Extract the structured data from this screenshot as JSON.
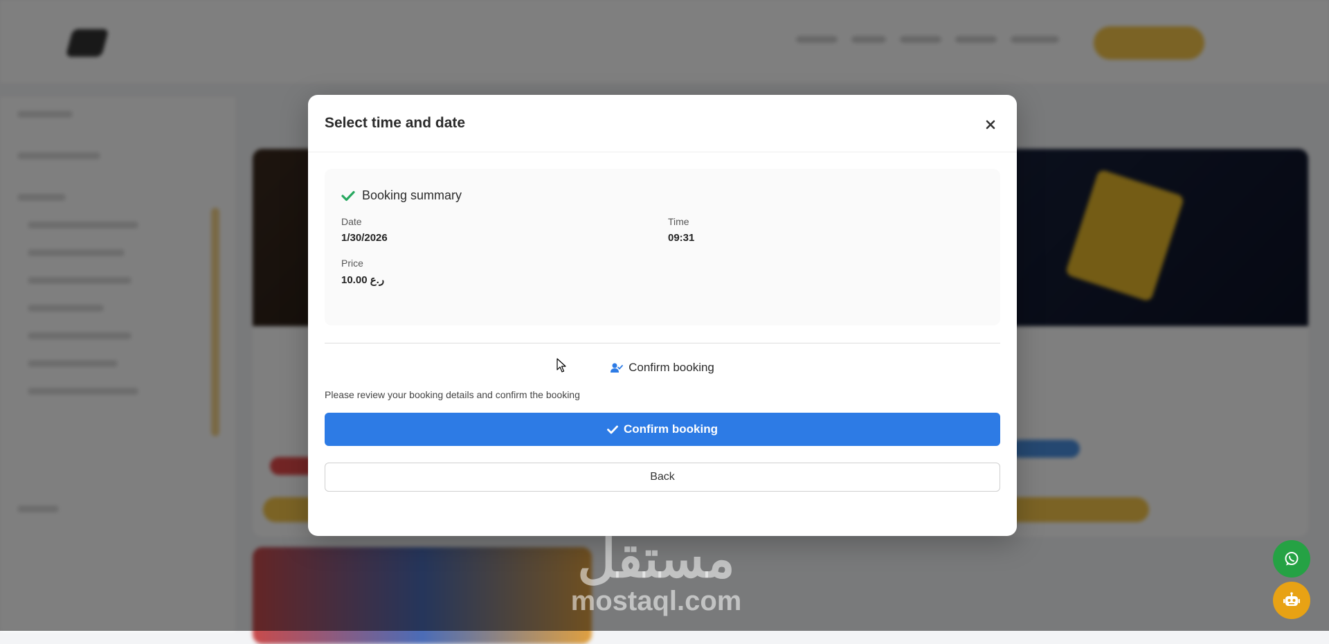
{
  "modal": {
    "title": "Select time and date",
    "close_icon": "close-icon",
    "summary": {
      "heading": "Booking summary",
      "date_label": "Date",
      "date_value": "1/30/2026",
      "time_label": "Time",
      "time_value": "09:31",
      "price_label": "Price",
      "price_value": "10.00 ر.ع"
    },
    "confirm_section": {
      "heading": "Confirm booking",
      "instructions": "Please review your booking details and confirm the booking",
      "confirm_button": "Confirm booking",
      "back_button": "Back"
    }
  },
  "watermark": {
    "arabic": "مستقل",
    "latin": "mostaql.com"
  },
  "colors": {
    "primary": "#2d7be5",
    "success_check": "#27a85f",
    "whatsapp": "#25a244",
    "bot": "#e8a214"
  }
}
